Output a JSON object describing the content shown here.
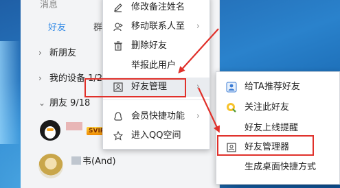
{
  "desktop": {},
  "qq": {
    "top_label": "消息",
    "tabs": [
      {
        "label": "好友"
      },
      {
        "label": "群"
      }
    ],
    "groups": [
      {
        "label": "新朋友"
      },
      {
        "label": "我的设备 1/2"
      },
      {
        "label": "朋友 9/18"
      }
    ],
    "contacts": [
      {
        "name": "",
        "badge": "SVIP"
      },
      {
        "name": "韦(And)"
      }
    ]
  },
  "context_menu": {
    "items": [
      {
        "label": "修改备注姓名",
        "icon": "edit-icon"
      },
      {
        "label": "移动联系人至",
        "icon": "move-icon",
        "has_submenu": true
      },
      {
        "label": "删除好友",
        "icon": "trash-icon"
      },
      {
        "label": "举报此用户",
        "icon": ""
      },
      {
        "label": "好友管理",
        "icon": "user-card-icon",
        "has_submenu": true
      },
      {
        "label": "会员快捷功能",
        "icon": "penguin-outline-icon",
        "has_submenu": true
      },
      {
        "label": "进入QQ空间",
        "icon": "star-icon"
      }
    ]
  },
  "submenu": {
    "items": [
      {
        "label": "给TA推荐好友",
        "icon": "recommend-icon"
      },
      {
        "label": "关注此好友",
        "icon": "follow-icon"
      },
      {
        "label": "好友上线提醒",
        "icon": ""
      },
      {
        "label": "好友管理器",
        "icon": "user-card-icon"
      },
      {
        "label": "生成桌面快捷方式",
        "icon": ""
      }
    ]
  },
  "colors": {
    "highlight_border": "#e0302a",
    "tab_active": "#3a8ee6"
  }
}
